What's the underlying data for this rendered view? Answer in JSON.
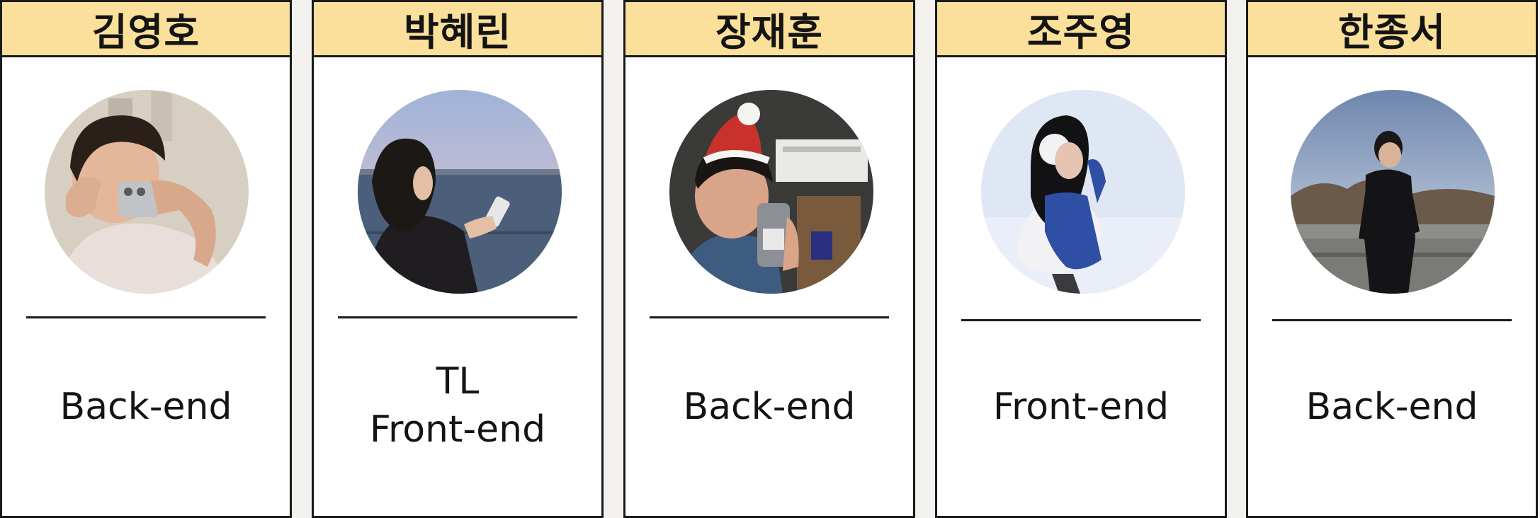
{
  "members": [
    {
      "name": "김영호",
      "roles": [
        "Back-end"
      ],
      "photo": {
        "background": "#d7cfc2",
        "skin": "#e4b79a",
        "hair": "#2a2019",
        "clothing": "#e8dfda",
        "prop": "#c0c4c8"
      }
    },
    {
      "name": "박혜린",
      "roles": [
        "TL",
        "Front-end"
      ],
      "photo": {
        "sky": "#c4c7dc",
        "water": "#4b5f7a",
        "hair": "#1b1815",
        "clothing": "#1f1d20",
        "prop": "#e7e7e7"
      }
    },
    {
      "name": "장재훈",
      "roles": [
        "Back-end"
      ],
      "photo": {
        "background": "#3a3a38",
        "skin": "#d9a487",
        "hair": "#181512",
        "clothing": "#3d5c80",
        "hat": "#c8322b",
        "prop": "#8c8f95"
      }
    },
    {
      "name": "조주영",
      "roles": [
        "Front-end"
      ],
      "photo": {
        "background": "#dfe6f4",
        "hair": "#121214",
        "clothing": "#f2f2f4",
        "scarf": "#2e4fa3"
      }
    },
    {
      "name": "한종서",
      "roles": [
        "Back-end"
      ],
      "photo": {
        "sky": "#8fa4c4",
        "glow": "#f2c98a",
        "trees": "#6b5a4a",
        "railing": "#8d8d8a",
        "clothing": "#141416"
      }
    }
  ]
}
